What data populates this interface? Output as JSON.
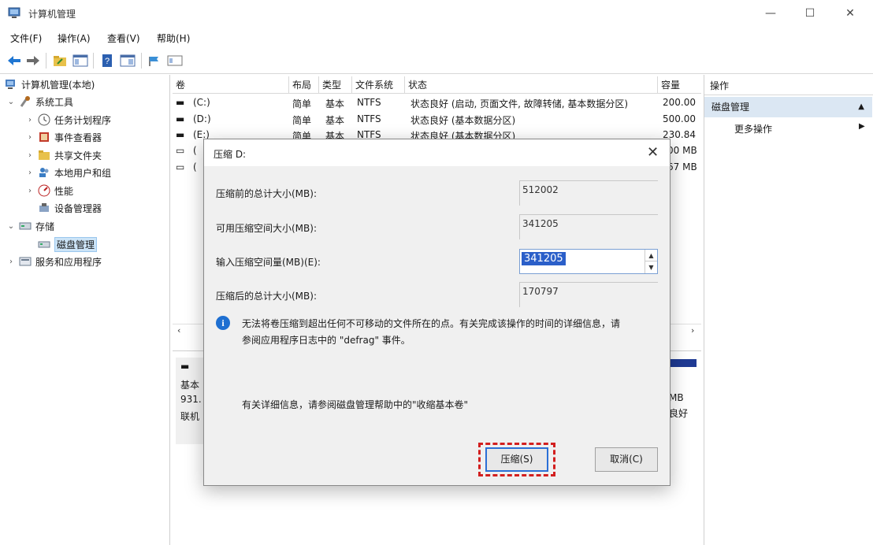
{
  "window": {
    "title": "计算机管理",
    "minimize": "—",
    "maximize": "☐",
    "close": "✕"
  },
  "menu": [
    "文件(F)",
    "操作(A)",
    "查看(V)",
    "帮助(H)"
  ],
  "tree": {
    "root": "计算机管理(本地)",
    "system_tools": "系统工具",
    "task_scheduler": "任务计划程序",
    "event_viewer": "事件查看器",
    "shared_folders": "共享文件夹",
    "local_users": "本地用户和组",
    "performance": "性能",
    "device_manager": "设备管理器",
    "storage": "存储",
    "disk_management": "磁盘管理",
    "services_apps": "服务和应用程序"
  },
  "volumes": {
    "headers": [
      "卷",
      "布局",
      "类型",
      "文件系统",
      "状态",
      "容量"
    ],
    "rows": [
      {
        "vol": "(C:)",
        "layout": "简单",
        "type": "基本",
        "fs": "NTFS",
        "status": "状态良好 (启动, 页面文件, 故障转储, 基本数据分区)",
        "capacity": "200.00"
      },
      {
        "vol": "(D:)",
        "layout": "简单",
        "type": "基本",
        "fs": "NTFS",
        "status": "状态良好 (基本数据分区)",
        "capacity": "500.00"
      },
      {
        "vol": "(E:)",
        "layout": "简单",
        "type": "基本",
        "fs": "NTFS",
        "status": "状态良好 (基本数据分区)",
        "capacity": "230.84"
      },
      {
        "vol": "(",
        "layout": "",
        "type": "",
        "fs": "",
        "status": "",
        "capacity": "00 MB"
      },
      {
        "vol": "(",
        "layout": "",
        "type": "",
        "fs": "",
        "status": "",
        "capacity": "67 MB"
      }
    ]
  },
  "lower": {
    "l1": "基本",
    "l2": "931.",
    "l3": "联机",
    "r1": "MB",
    "r2": "良好"
  },
  "actions": {
    "header": "操作",
    "section": "磁盘管理",
    "more": "更多操作"
  },
  "dialog": {
    "title": "压缩 D:",
    "total_label": "压缩前的总计大小(MB):",
    "total_value": "512002",
    "avail_label": "可用压缩空间大小(MB):",
    "avail_value": "341205",
    "input_label": "输入压缩空间量(MB)(E):",
    "input_value": "341205",
    "after_label": "压缩后的总计大小(MB):",
    "after_value": "170797",
    "info_line1": "无法将卷压缩到超出任何不可移动的文件所在的点。有关完成该操作的时间的详细信息，请",
    "info_line2": "参阅应用程序日志中的 \"defrag\" 事件。",
    "help": "有关详细信息，请参阅磁盘管理帮助中的\"收缩基本卷\"",
    "ok": "压缩(S)",
    "cancel": "取消(C)"
  }
}
